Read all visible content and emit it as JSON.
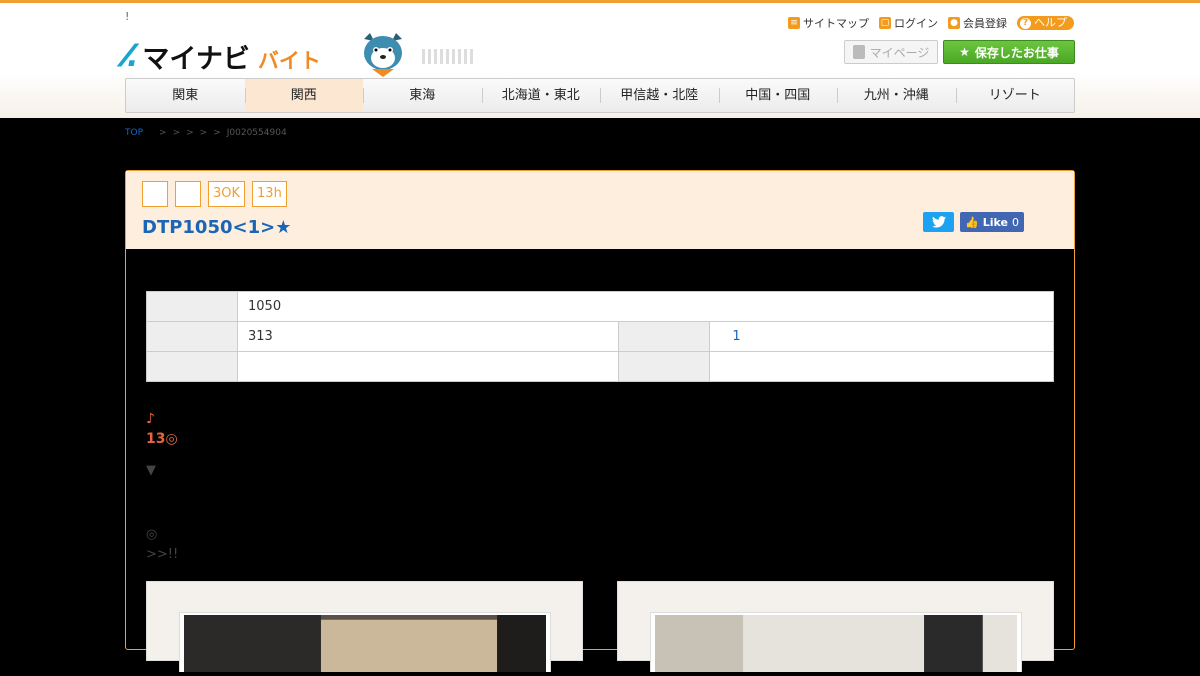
{
  "header": {
    "notice": "!",
    "logo_text": "マイナビ",
    "logo_sub": "バイト",
    "top_links": [
      {
        "label": "サイトマップ",
        "icon": "sitemap-icon"
      },
      {
        "label": "ログイン",
        "icon": "lock-icon"
      },
      {
        "label": "会員登録",
        "icon": "member-icon"
      }
    ],
    "help_label": "ヘルプ",
    "mypage_label": "マイページ",
    "saved_label": "保存したお仕事"
  },
  "nav": {
    "items": [
      "関東",
      "関西",
      "東海",
      "北海道・東北",
      "甲信越・北陸",
      "中国・四国",
      "九州・沖縄",
      "リゾート"
    ],
    "active_index": 1
  },
  "breadcrumb": {
    "top": "TOP",
    "separators": [
      ">",
      ">",
      ">",
      ">",
      ">"
    ],
    "current": "J0020554904"
  },
  "job": {
    "tags": [
      "",
      "",
      "3OK",
      "13h"
    ],
    "title": "DTP1050<1>★",
    "like_label": "Like",
    "like_count": "0",
    "table": {
      "row1": {
        "value": "1050"
      },
      "row2": {
        "value_left": "313",
        "value_right": "1"
      },
      "row3": {
        "value_left": "",
        "value_right": ""
      }
    },
    "pr": {
      "note": "♪",
      "headline": "13◎",
      "arrow": "▼",
      "mark": "◎",
      "more": ">>!!"
    }
  },
  "colors": {
    "accent": "#f0a030",
    "link": "#1a65b8",
    "highlight_text": "#e8643c",
    "save_green": "#4aa825"
  }
}
